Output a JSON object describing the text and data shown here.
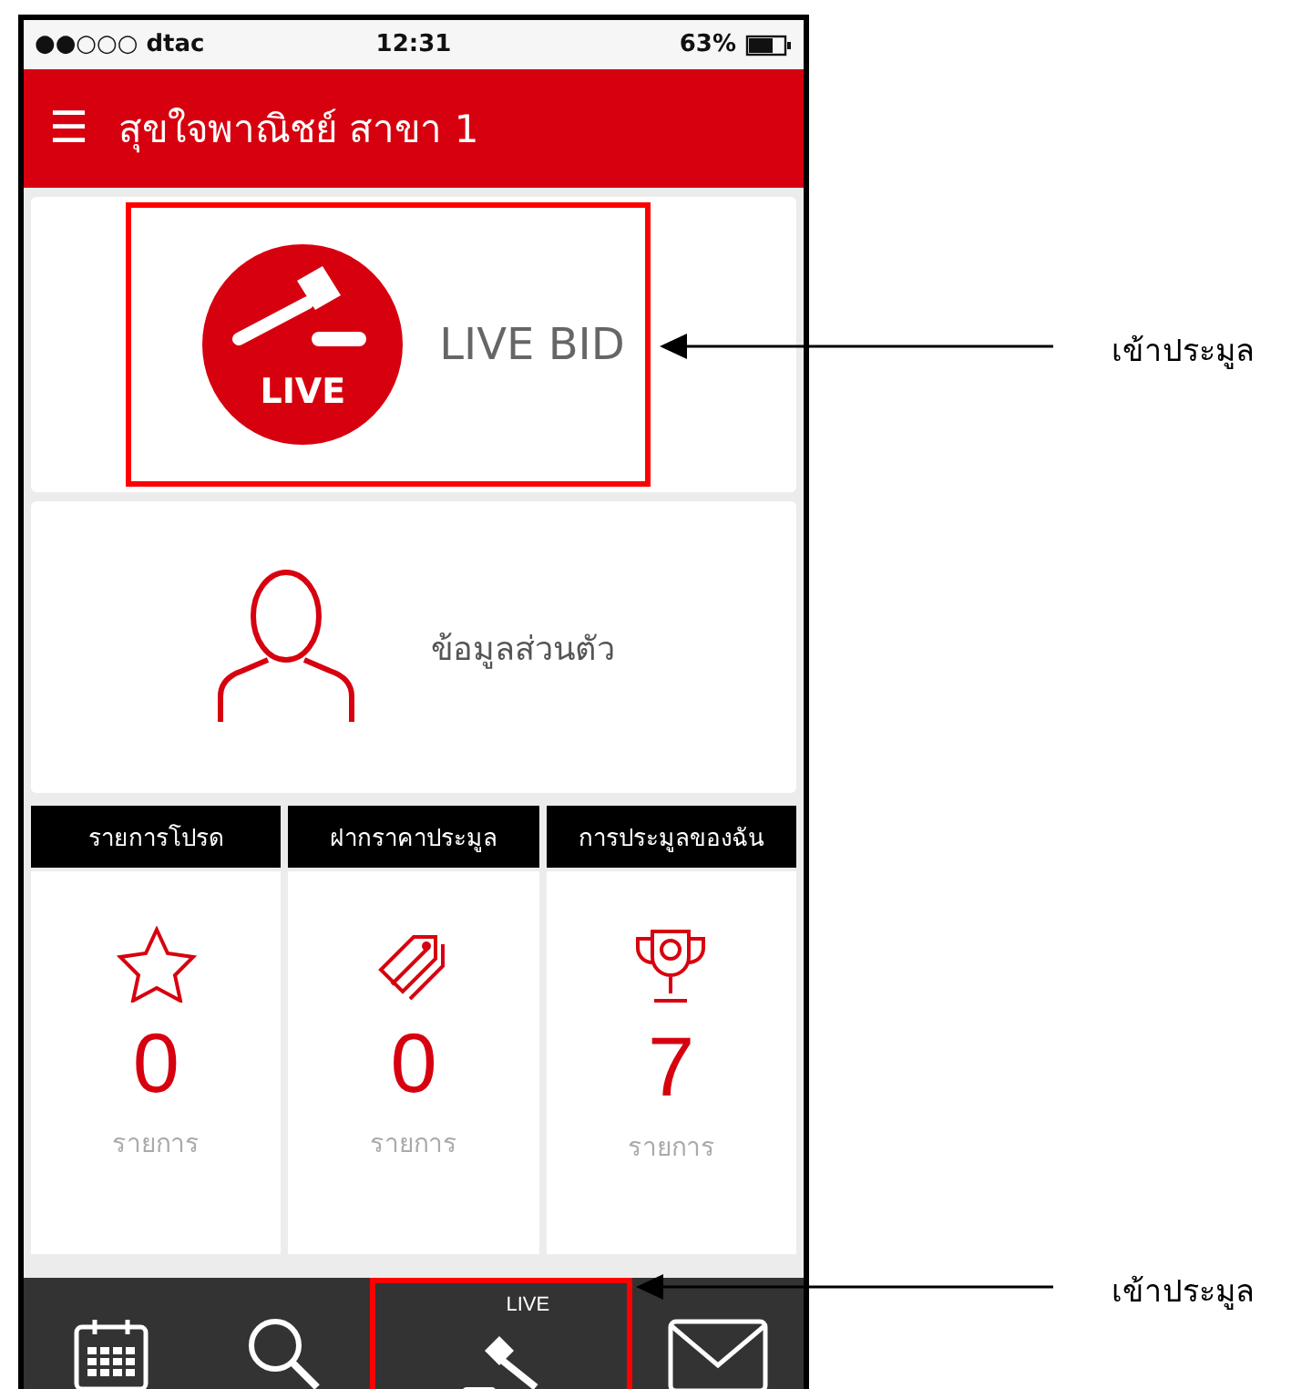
{
  "status_bar": {
    "carrier": "●●○○○ dtac",
    "time": "12:31",
    "battery": "63%"
  },
  "header": {
    "menu_glyph": "☰",
    "title": "สุขใจพาณิชย์ สาขา 1"
  },
  "live_card": {
    "badge": "LIVE",
    "label": "LIVE BID",
    "highlighted": true
  },
  "profile_card": {
    "label": "ข้อมูลส่วนตัว"
  },
  "stats": [
    {
      "kind": "star",
      "title": "รายการโปรด",
      "count": "0",
      "unit": "รายการ"
    },
    {
      "kind": "tag",
      "title": "ฝากราคาประมูล",
      "count": "0",
      "unit": "รายการ"
    },
    {
      "kind": "trophy",
      "title": "การประมูลของฉัน",
      "count": "7",
      "unit": "รายการ"
    }
  ],
  "tab_bar": [
    {
      "kind": "calendar",
      "highlighted": false
    },
    {
      "kind": "search",
      "highlighted": false
    },
    {
      "kind": "live",
      "badge": "LIVE",
      "highlighted": true
    },
    {
      "kind": "mail",
      "highlighted": false
    }
  ],
  "annotations": [
    {
      "label": "เข้าประมูล"
    },
    {
      "label": "เข้าประมูล"
    }
  ]
}
